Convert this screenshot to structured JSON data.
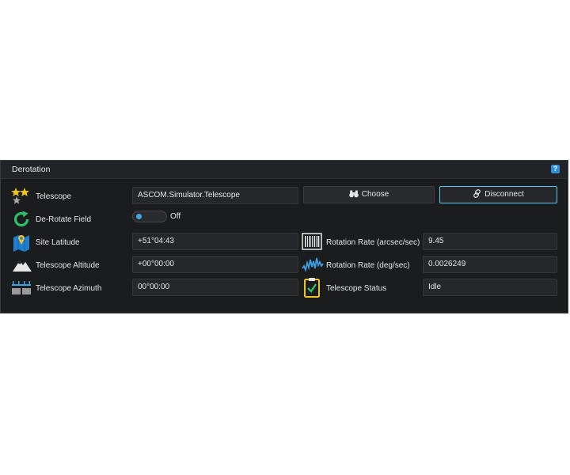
{
  "panel": {
    "title": "Derotation",
    "help_icon": "?"
  },
  "telescope": {
    "label": "Telescope",
    "value": "ASCOM.Simulator.Telescope",
    "choose_label": "Choose",
    "disconnect_label": "Disconnect"
  },
  "derotate": {
    "label": "De-Rotate Field",
    "state": "Off"
  },
  "rows_left": {
    "latitude": {
      "label": "Site Latitude",
      "value": "+51°04:43"
    },
    "altitude": {
      "label": "Telescope Altitude",
      "value": "+00°00:00"
    },
    "azimuth": {
      "label": "Telescope Azimuth",
      "value": "00°00:00"
    }
  },
  "rows_right": {
    "rate_arcsec": {
      "label": "Rotation Rate (arcsec/sec)",
      "value": "9.45"
    },
    "rate_deg": {
      "label": "Rotation Rate (deg/sec)",
      "value": "0.0026249"
    },
    "status": {
      "label": "Telescope Status",
      "value": "Idle"
    }
  },
  "icons": [
    "stars-icon",
    "rotate-icon",
    "map-pin-icon",
    "mountain-icon",
    "azimuth-ruler-icon",
    "barcode-icon",
    "waveform-icon",
    "clipboard-check-icon",
    "binoculars-icon",
    "link-icon"
  ],
  "colors": {
    "accent": "#58c7ef",
    "toggle_knob": "#3ea9e0",
    "rotate": "#2dbf6c",
    "help": "#2e8fd6"
  }
}
